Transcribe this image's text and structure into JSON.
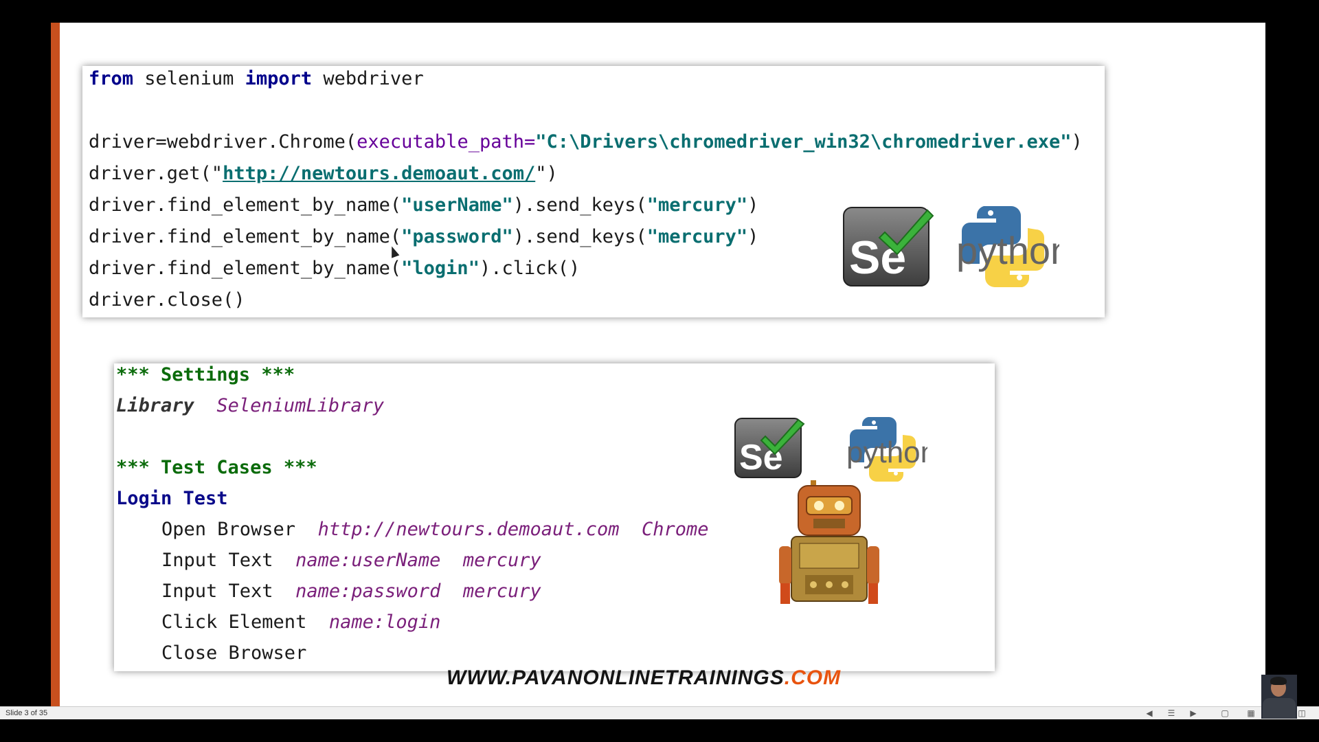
{
  "python_code": {
    "line1_kw1": "from",
    "line1_mod": " selenium ",
    "line1_kw2": "import",
    "line1_rest": " webdriver",
    "line2_pre": "driver=webdriver.Chrome(",
    "line2_param": "executable_path=",
    "line2_str": "\"C:\\Drivers\\chromedriver_win32\\chromedriver.exe\"",
    "line2_post": ")",
    "line3_pre": "driver.get(\"",
    "line3_url": "http://newtours.demoaut.com/",
    "line3_post": "\")",
    "line4_pre": "driver.find_element_by_name(",
    "line4_arg1": "\"userName\"",
    "line4_mid": ").send_keys(",
    "line4_arg2": "\"mercury\"",
    "line4_post": ")",
    "line5_pre": "driver.find_element_by_name(",
    "line5_arg1": "\"password\"",
    "line5_mid": ").send_keys(",
    "line5_arg2": "\"mercury\"",
    "line5_post": ")",
    "line6_pre": "driver.find_element_by_name(",
    "line6_arg": "\"login\"",
    "line6_post": ").click()",
    "line7": "driver.close()"
  },
  "robot_code": {
    "settings_header": "*** Settings ***",
    "library_kw": "Library",
    "library_name": "SeleniumLibrary",
    "testcases_header": "*** Test Cases ***",
    "test_name": "Login Test",
    "step1_kw": "Open Browser",
    "step1_arg1": "http://newtours.demoaut.com",
    "step1_arg2": "Chrome",
    "step2_kw": "Input Text",
    "step2_arg1": "name:userName",
    "step2_arg2": "mercury",
    "step3_kw": "Input Text",
    "step3_arg1": "name:password",
    "step3_arg2": "mercury",
    "step4_kw": "Click Element",
    "step4_arg1": "name:login",
    "step5_kw": "Close Browser"
  },
  "logos": {
    "selenium_text": "Se",
    "python_text": "python"
  },
  "watermark": {
    "main": "WWW.PAVANONLINETRAININGS",
    "suffix": ".COM"
  },
  "status_bar": {
    "slide_counter": "Slide 3 of 35"
  },
  "colors": {
    "accent_bar": "#c8501e",
    "watermark_suffix": "#e8530e"
  }
}
